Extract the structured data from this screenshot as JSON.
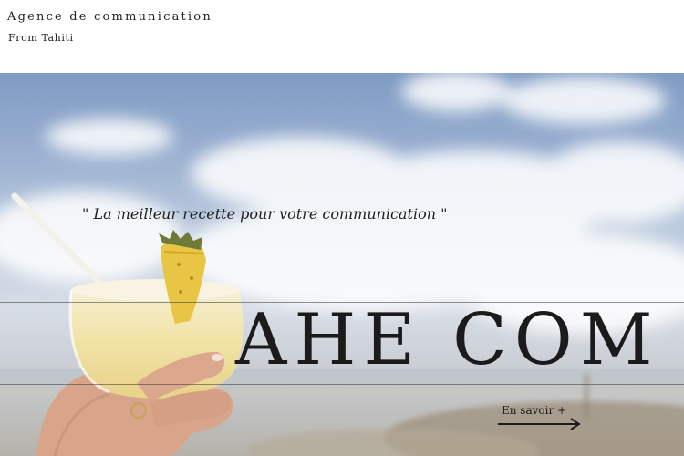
{
  "header": {
    "brand_title": "Agence de communication",
    "brand_subtitle": "From Tahiti"
  },
  "hero": {
    "tagline": "\" La meilleur recette pour votre communication \"",
    "brand_name": "AHE COM",
    "cta_label": "En savoir +",
    "image_subject": "pineapple-cocktail-on-beach",
    "arrow_icon": "arrow-right-icon"
  },
  "colors": {
    "text": "#1b1b1b",
    "sky": "#8aa3c8",
    "drink": "#f3e3a6"
  }
}
